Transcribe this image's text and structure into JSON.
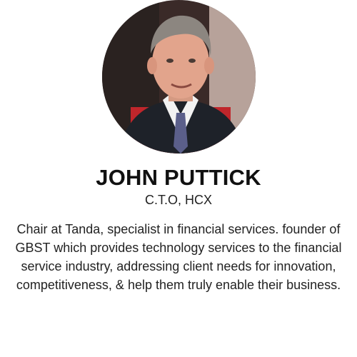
{
  "profile": {
    "name": "JOHN PUTTICK",
    "role": "C.T.O, HCX",
    "bio": "Chair at Tanda, specialist in financial services. founder of GBST which provides technology services to the financial service industry, addressing client needs for innovation, competitiveness, & help them truly enable their business.",
    "photo": "portrait-photo"
  }
}
